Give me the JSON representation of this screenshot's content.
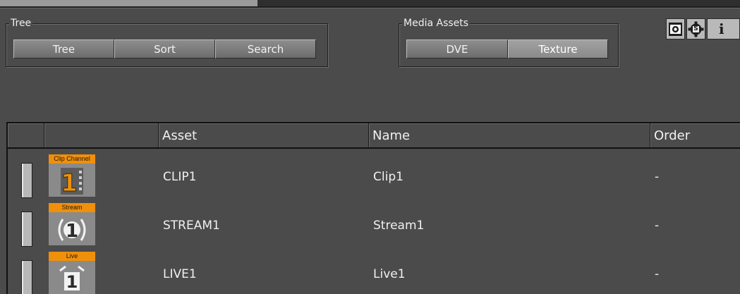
{
  "groups": {
    "tree": {
      "title": "Tree",
      "buttons": [
        "Tree",
        "Sort",
        "Search"
      ]
    },
    "media": {
      "title": "Media Assets",
      "buttons": [
        "DVE",
        "Texture"
      ],
      "active": "Texture"
    }
  },
  "toolbar_icons": [
    "screenshot-icon",
    "script-icon",
    "info-icon"
  ],
  "info_glyph": "i",
  "script_glyph": "S",
  "table": {
    "columns": [
      "",
      "",
      "Asset",
      "Name",
      "Order"
    ],
    "rows": [
      {
        "tag": "Clip Channel",
        "glyph": "1",
        "icon": "clip-channel-icon",
        "asset": "CLIP1",
        "name": "Clip1",
        "order": "-"
      },
      {
        "tag": "Stream",
        "glyph": "1",
        "icon": "stream-icon",
        "asset": "STREAM1",
        "name": "Stream1",
        "order": "-"
      },
      {
        "tag": "Live",
        "glyph": "1",
        "icon": "live-icon",
        "asset": "LIVE1",
        "name": "Live1",
        "order": "-"
      }
    ]
  },
  "colors": {
    "background": "#4b4b4b",
    "tag": "#f0900a",
    "button": "#7c7c7c"
  }
}
